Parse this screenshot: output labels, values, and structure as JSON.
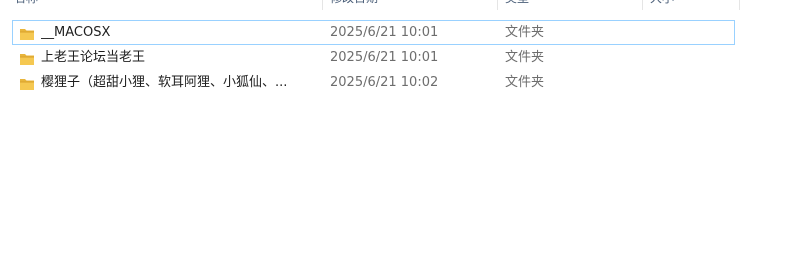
{
  "columns": {
    "name": "名称",
    "date_modified": "修改日期",
    "type": "类型",
    "size": "大小"
  },
  "files": [
    {
      "name": "__MACOSX",
      "date_modified": "2025/6/21 10:01",
      "type": "文件夹",
      "icon": "folder-icon",
      "selected": true
    },
    {
      "name": "上老王论坛当老王",
      "date_modified": "2025/6/21 10:01",
      "type": "文件夹",
      "icon": "folder-icon",
      "selected": false
    },
    {
      "name": "樱狸子（超甜小狸、软耳阿狸、小狐仙、...",
      "date_modified": "2025/6/21 10:02",
      "type": "文件夹",
      "icon": "folder-icon",
      "selected": false
    }
  ],
  "colors": {
    "selection_border": "#99d1ff",
    "folder": "#e8b53c",
    "folder_dark": "#d9a12a"
  }
}
